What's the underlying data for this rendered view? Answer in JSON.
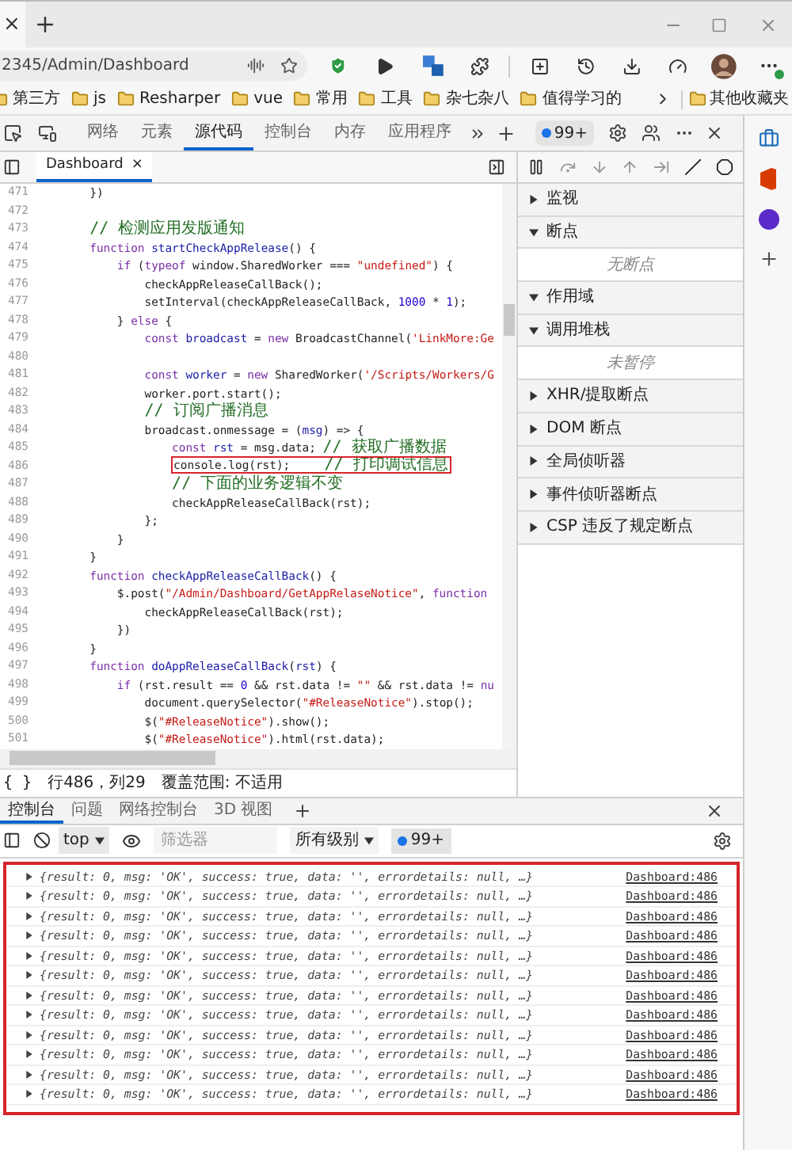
{
  "browser": {
    "tab_close": "×",
    "address": "2345/Admin/Dashboard",
    "bookmarks": [
      {
        "label": "第三方"
      },
      {
        "label": "js"
      },
      {
        "label": "Resharper"
      },
      {
        "label": "vue"
      },
      {
        "label": "常用"
      },
      {
        "label": "工具"
      },
      {
        "label": "杂七杂八"
      },
      {
        "label": "值得学习的"
      }
    ],
    "other_bookmarks": "其他收藏夹"
  },
  "devtools": {
    "tabs": [
      {
        "label": "网络",
        "selected": false
      },
      {
        "label": "元素",
        "selected": false
      },
      {
        "label": "源代码",
        "selected": true
      },
      {
        "label": "控制台",
        "selected": false
      },
      {
        "label": "内存",
        "selected": false
      },
      {
        "label": "应用程序",
        "selected": false
      }
    ],
    "issues_badge": "99+",
    "file_tab": {
      "label": "Dashboard",
      "close": "×",
      "selected": true
    },
    "code_lines": [
      {
        "number": "471",
        "tokens": [
          {
            "kind": "plain",
            "text": "        })"
          }
        ]
      },
      {
        "number": "472"
      },
      {
        "number": "473",
        "tokens": [
          {
            "kind": "comment",
            "text": "        // 检测应用发版通知"
          }
        ]
      },
      {
        "number": "474",
        "tokens": [
          {
            "kind": "keyword",
            "text": "        function "
          },
          {
            "kind": "def",
            "text": "startCheckAppRelease"
          },
          {
            "kind": "plain",
            "text": "() {"
          }
        ]
      },
      {
        "number": "475",
        "tokens": [
          {
            "kind": "keyword",
            "text": "            if"
          },
          {
            "kind": "plain",
            "text": " ("
          },
          {
            "kind": "keyword",
            "text": "typeof"
          },
          {
            "kind": "plain",
            "text": " window.SharedWorker === "
          },
          {
            "kind": "string",
            "text": "\"undefined\""
          },
          {
            "kind": "plain",
            "text": ") {"
          }
        ]
      },
      {
        "number": "476",
        "tokens": [
          {
            "kind": "plain",
            "text": "                checkAppReleaseCallBack();"
          }
        ]
      },
      {
        "number": "477",
        "tokens": [
          {
            "kind": "plain",
            "text": "                setInterval(checkAppReleaseCallBack, "
          },
          {
            "kind": "number",
            "text": "1000"
          },
          {
            "kind": "plain",
            "text": " * "
          },
          {
            "kind": "number",
            "text": "1"
          },
          {
            "kind": "plain",
            "text": ");"
          }
        ]
      },
      {
        "number": "478",
        "tokens": [
          {
            "kind": "plain",
            "text": "            } "
          },
          {
            "kind": "keyword",
            "text": "else"
          },
          {
            "kind": "plain",
            "text": " {"
          }
        ]
      },
      {
        "number": "479",
        "tokens": [
          {
            "kind": "keyword",
            "text": "                const "
          },
          {
            "kind": "def",
            "text": "broadcast"
          },
          {
            "kind": "plain",
            "text": " = "
          },
          {
            "kind": "keyword",
            "text": "new"
          },
          {
            "kind": "plain",
            "text": " BroadcastChannel("
          },
          {
            "kind": "string",
            "text": "'LinkMore:Ge"
          }
        ]
      },
      {
        "number": "480"
      },
      {
        "number": "481",
        "tokens": [
          {
            "kind": "keyword",
            "text": "                const "
          },
          {
            "kind": "def",
            "text": "worker"
          },
          {
            "kind": "plain",
            "text": " = "
          },
          {
            "kind": "keyword",
            "text": "new"
          },
          {
            "kind": "plain",
            "text": " SharedWorker("
          },
          {
            "kind": "string",
            "text": "'/Scripts/Workers/G"
          }
        ]
      },
      {
        "number": "482",
        "tokens": [
          {
            "kind": "plain",
            "text": "                worker.port.start();"
          }
        ]
      },
      {
        "number": "483",
        "tokens": [
          {
            "kind": "comment",
            "text": "                // 订阅广播消息"
          }
        ]
      },
      {
        "number": "484",
        "tokens": [
          {
            "kind": "plain",
            "text": "                broadcast.onmessage = ("
          },
          {
            "kind": "def",
            "text": "msg"
          },
          {
            "kind": "plain",
            "text": ") => {"
          }
        ]
      },
      {
        "number": "485",
        "tokens": [
          {
            "kind": "keyword",
            "text": "                    const "
          },
          {
            "kind": "def",
            "text": "rst"
          },
          {
            "kind": "plain",
            "text": " = msg.data; "
          },
          {
            "kind": "comment",
            "text": "// 获取广播数据"
          }
        ]
      },
      {
        "number": "486",
        "highlighted": true,
        "tokens": [
          {
            "kind": "plain",
            "text": "                    console.log(rst);     "
          },
          {
            "kind": "comment",
            "text": "// 打印调试信息"
          }
        ]
      },
      {
        "number": "487",
        "tokens": [
          {
            "kind": "comment",
            "text": "                    // 下面的业务逻辑不变"
          }
        ]
      },
      {
        "number": "488",
        "tokens": [
          {
            "kind": "plain",
            "text": "                    checkAppReleaseCallBack(rst);"
          }
        ]
      },
      {
        "number": "489",
        "tokens": [
          {
            "kind": "plain",
            "text": "                };"
          }
        ]
      },
      {
        "number": "490",
        "tokens": [
          {
            "kind": "plain",
            "text": "            }"
          }
        ]
      },
      {
        "number": "491",
        "tokens": [
          {
            "kind": "plain",
            "text": "        }"
          }
        ]
      },
      {
        "number": "492",
        "tokens": [
          {
            "kind": "keyword",
            "text": "        function "
          },
          {
            "kind": "def",
            "text": "checkAppReleaseCallBack"
          },
          {
            "kind": "plain",
            "text": "() {"
          }
        ]
      },
      {
        "number": "493",
        "tokens": [
          {
            "kind": "plain",
            "text": "            $.post("
          },
          {
            "kind": "string",
            "text": "\"/Admin/Dashboard/GetAppRelaseNotice\""
          },
          {
            "kind": "plain",
            "text": ", "
          },
          {
            "kind": "keyword",
            "text": "function"
          }
        ]
      },
      {
        "number": "494",
        "tokens": [
          {
            "kind": "plain",
            "text": "                checkAppReleaseCallBack(rst);"
          }
        ]
      },
      {
        "number": "495",
        "tokens": [
          {
            "kind": "plain",
            "text": "            })"
          }
        ]
      },
      {
        "number": "496",
        "tokens": [
          {
            "kind": "plain",
            "text": "        }"
          }
        ]
      },
      {
        "number": "497",
        "tokens": [
          {
            "kind": "keyword",
            "text": "        function "
          },
          {
            "kind": "def",
            "text": "doAppReleaseCallBack"
          },
          {
            "kind": "plain",
            "text": "("
          },
          {
            "kind": "def",
            "text": "rst"
          },
          {
            "kind": "plain",
            "text": ") {"
          }
        ]
      },
      {
        "number": "498",
        "tokens": [
          {
            "kind": "keyword",
            "text": "            if"
          },
          {
            "kind": "plain",
            "text": " (rst.result == "
          },
          {
            "kind": "number",
            "text": "0"
          },
          {
            "kind": "plain",
            "text": " && rst.data != "
          },
          {
            "kind": "string",
            "text": "\"\""
          },
          {
            "kind": "plain",
            "text": " && rst.data != "
          },
          {
            "kind": "keyword",
            "text": "nu"
          }
        ]
      },
      {
        "number": "499",
        "tokens": [
          {
            "kind": "plain",
            "text": "                document.querySelector("
          },
          {
            "kind": "string",
            "text": "\"#ReleaseNotice\""
          },
          {
            "kind": "plain",
            "text": ").stop();"
          }
        ]
      },
      {
        "number": "500",
        "tokens": [
          {
            "kind": "plain",
            "text": "                $("
          },
          {
            "kind": "string",
            "text": "\"#ReleaseNotice\""
          },
          {
            "kind": "plain",
            "text": ").show();"
          }
        ]
      },
      {
        "number": "501",
        "tokens": [
          {
            "kind": "plain",
            "text": "                $("
          },
          {
            "kind": "string",
            "text": "\"#ReleaseNotice\""
          },
          {
            "kind": "plain",
            "text": ").html(rst.data);"
          }
        ]
      }
    ],
    "status": {
      "pretty_print": "{ }",
      "position": "行486，列29",
      "coverage": "覆盖范围: 不适用"
    },
    "debugger_sections": [
      {
        "label": "监视",
        "expanded": false
      },
      {
        "label": "断点",
        "expanded": true,
        "message": "无断点"
      },
      {
        "label": "作用域",
        "expanded": true
      },
      {
        "label": "调用堆栈",
        "expanded": true,
        "message": "未暂停"
      },
      {
        "label": "XHR/提取断点",
        "expanded": false
      },
      {
        "label": "DOM 断点",
        "expanded": false
      },
      {
        "label": "全局侦听器",
        "expanded": false
      },
      {
        "label": "事件侦听器断点",
        "expanded": false
      },
      {
        "label": "CSP 违反了规定断点",
        "expanded": false
      }
    ],
    "drawer_tabs": [
      {
        "label": "控制台",
        "selected": true
      },
      {
        "label": "问题",
        "selected": false
      },
      {
        "label": "网络控制台",
        "selected": false
      },
      {
        "label": "3D 视图",
        "selected": false
      }
    ],
    "console_toolbar": {
      "context": "top",
      "filter_placeholder": "筛选器",
      "levels": "所有级别",
      "badge": "99+"
    },
    "console": {
      "highlighted": true,
      "messages": [
        {
          "text": "{result: 0, msg: 'OK', success: true, data: '', errordetails: null, …}",
          "source": "Dashboard:486"
        },
        {
          "text": "{result: 0, msg: 'OK', success: true, data: '', errordetails: null, …}",
          "source": "Dashboard:486"
        },
        {
          "text": "{result: 0, msg: 'OK', success: true, data: '', errordetails: null, …}",
          "source": "Dashboard:486"
        },
        {
          "text": "{result: 0, msg: 'OK', success: true, data: '', errordetails: null, …}",
          "source": "Dashboard:486"
        },
        {
          "text": "{result: 0, msg: 'OK', success: true, data: '', errordetails: null, …}",
          "source": "Dashboard:486"
        },
        {
          "text": "{result: 0, msg: 'OK', success: true, data: '', errordetails: null, …}",
          "source": "Dashboard:486"
        },
        {
          "text": "{result: 0, msg: 'OK', success: true, data: '', errordetails: null, …}",
          "source": "Dashboard:486"
        },
        {
          "text": "{result: 0, msg: 'OK', success: true, data: '', errordetails: null, …}",
          "source": "Dashboard:486"
        },
        {
          "text": "{result: 0, msg: 'OK', success: true, data: '', errordetails: null, …}",
          "source": "Dashboard:486"
        },
        {
          "text": "{result: 0, msg: 'OK', success: true, data: '', errordetails: null, …}",
          "source": "Dashboard:486"
        },
        {
          "text": "{result: 0, msg: 'OK', success: true, data: '', errordetails: null, …}",
          "source": "Dashboard:486"
        },
        {
          "text": "{result: 0, msg: 'OK', success: true, data: '', errordetails: null, …}",
          "source": "Dashboard:486"
        }
      ]
    }
  }
}
